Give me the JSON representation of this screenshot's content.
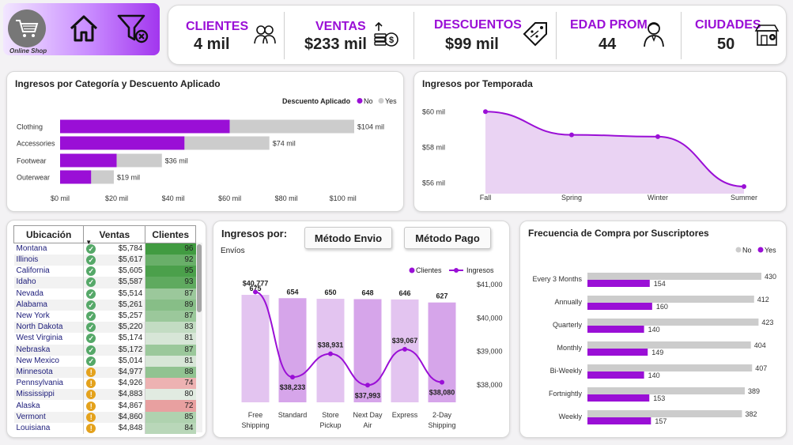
{
  "nav": {
    "brand": "Online Shop",
    "cart_icon": "shopping-cart-icon",
    "home_icon": "home-icon",
    "filter_icon": "clear-filter-icon"
  },
  "kpis": [
    {
      "label": "CLIENTES",
      "value": "4 mil",
      "icon": "people-icon"
    },
    {
      "label": "VENTAS",
      "value": "$233 mil",
      "icon": "money-icon"
    },
    {
      "label": "DESCUENTOS",
      "value": "$99 mil",
      "icon": "discount-tag-icon"
    },
    {
      "label": "EDAD PROM",
      "value": "44",
      "icon": "person-icon"
    },
    {
      "label": "CIUDADES",
      "value": "50",
      "icon": "store-location-icon"
    }
  ],
  "colors": {
    "accent": "#9a0fd6",
    "no": "#9a0fd6",
    "yes": "#cccccc",
    "area": "#ead3f3",
    "bar_light": "#e3c4f0"
  },
  "category_chart": {
    "title": "Ingresos por Categoría y Descuento Aplicado",
    "legend_title": "Descuento Aplicado",
    "legend": [
      "No",
      "Yes"
    ],
    "chart_data": {
      "type": "bar",
      "orientation": "horizontal",
      "stacked": true,
      "categories": [
        "Clothing",
        "Accessories",
        "Footwear",
        "Outerwear"
      ],
      "series": [
        {
          "name": "No",
          "values": [
            60,
            44,
            20,
            11
          ]
        },
        {
          "name": "Yes",
          "values": [
            44,
            30,
            16,
            8
          ]
        }
      ],
      "totals_labels": [
        "$104 mil",
        "$74 mil",
        "$36 mil",
        "$19 mil"
      ],
      "xticks": [
        "$0 mil",
        "$20 mil",
        "$40 mil",
        "$60 mil",
        "$80 mil",
        "$100 mil"
      ],
      "xlim": [
        0,
        104
      ]
    }
  },
  "season_chart": {
    "title": "Ingresos por Temporada",
    "chart_data": {
      "type": "area",
      "x": [
        "Fall",
        "Spring",
        "Winter",
        "Summer"
      ],
      "values": [
        60.0,
        58.7,
        58.6,
        55.8
      ],
      "yticks": [
        "$56 mil",
        "$58 mil",
        "$60 mil"
      ],
      "ytick_values": [
        56,
        58,
        60
      ],
      "ylim": [
        55.4,
        60.9
      ]
    }
  },
  "location_table": {
    "headers": [
      "Ubicación",
      "Ventas",
      "Clientes"
    ],
    "rows": [
      {
        "loc": "Montana",
        "ventas": "$5,784",
        "status": "ok",
        "clientes": 96
      },
      {
        "loc": "Illinois",
        "ventas": "$5,617",
        "status": "ok",
        "clientes": 92
      },
      {
        "loc": "California",
        "ventas": "$5,605",
        "status": "ok",
        "clientes": 95
      },
      {
        "loc": "Idaho",
        "ventas": "$5,587",
        "status": "ok",
        "clientes": 93
      },
      {
        "loc": "Nevada",
        "ventas": "$5,514",
        "status": "ok",
        "clientes": 87
      },
      {
        "loc": "Alabama",
        "ventas": "$5,261",
        "status": "ok",
        "clientes": 89
      },
      {
        "loc": "New York",
        "ventas": "$5,257",
        "status": "ok",
        "clientes": 87
      },
      {
        "loc": "North Dakota",
        "ventas": "$5,220",
        "status": "ok",
        "clientes": 83
      },
      {
        "loc": "West Virginia",
        "ventas": "$5,174",
        "status": "ok",
        "clientes": 81
      },
      {
        "loc": "Nebraska",
        "ventas": "$5,172",
        "status": "ok",
        "clientes": 87
      },
      {
        "loc": "New Mexico",
        "ventas": "$5,014",
        "status": "ok",
        "clientes": 81
      },
      {
        "loc": "Minnesota",
        "ventas": "$4,977",
        "status": "warn",
        "clientes": 88
      },
      {
        "loc": "Pennsylvania",
        "ventas": "$4,926",
        "status": "warn",
        "clientes": 74
      },
      {
        "loc": "Mississippi",
        "ventas": "$4,883",
        "status": "warn",
        "clientes": 80
      },
      {
        "loc": "Alaska",
        "ventas": "$4,867",
        "status": "warn",
        "clientes": 72
      },
      {
        "loc": "Vermont",
        "ventas": "$4,860",
        "status": "warn",
        "clientes": 85
      },
      {
        "loc": "Louisiana",
        "ventas": "$4,848",
        "status": "warn",
        "clientes": 84
      }
    ]
  },
  "shipping_chart": {
    "title": "Ingresos por:",
    "subtitle": "Envíos",
    "buttons": [
      "Método Envio",
      "Método Pago"
    ],
    "legend": [
      "Clientes",
      "Ingresos"
    ],
    "chart_data": {
      "type": "bar",
      "combo": "bar+line",
      "categories": [
        "Free Shipping",
        "Standard",
        "Store Pickup",
        "Next Day Air",
        "Express",
        "2-Day Shipping"
      ],
      "series": [
        {
          "name": "Clientes",
          "values": [
            675,
            654,
            650,
            648,
            646,
            627
          ]
        },
        {
          "name": "Ingresos",
          "values": [
            40777,
            38233,
            38931,
            37993,
            39067,
            38080
          ]
        }
      ],
      "line_labels": [
        "$40,777",
        "$38,233",
        "$38,931",
        "$37,993",
        "$39,067",
        "$38,080"
      ],
      "yticks_right": [
        "$41,000",
        "$40,000",
        "$39,000",
        "$38,000"
      ],
      "ytick_values_right": [
        41000,
        40000,
        39000,
        38000
      ]
    }
  },
  "frequency_chart": {
    "title": "Frecuencia de Compra por Suscriptores",
    "legend": [
      "No",
      "Yes"
    ],
    "chart_data": {
      "type": "bar",
      "orientation": "horizontal",
      "categories": [
        "Every 3 Months",
        "Annually",
        "Quarterly",
        "Monthly",
        "Bi-Weekly",
        "Fortnightly",
        "Weekly"
      ],
      "series": [
        {
          "name": "No",
          "values": [
            430,
            412,
            423,
            404,
            407,
            389,
            382
          ]
        },
        {
          "name": "Yes",
          "values": [
            154,
            160,
            140,
            149,
            140,
            153,
            157
          ]
        }
      ],
      "xlim": [
        0,
        430
      ]
    }
  }
}
